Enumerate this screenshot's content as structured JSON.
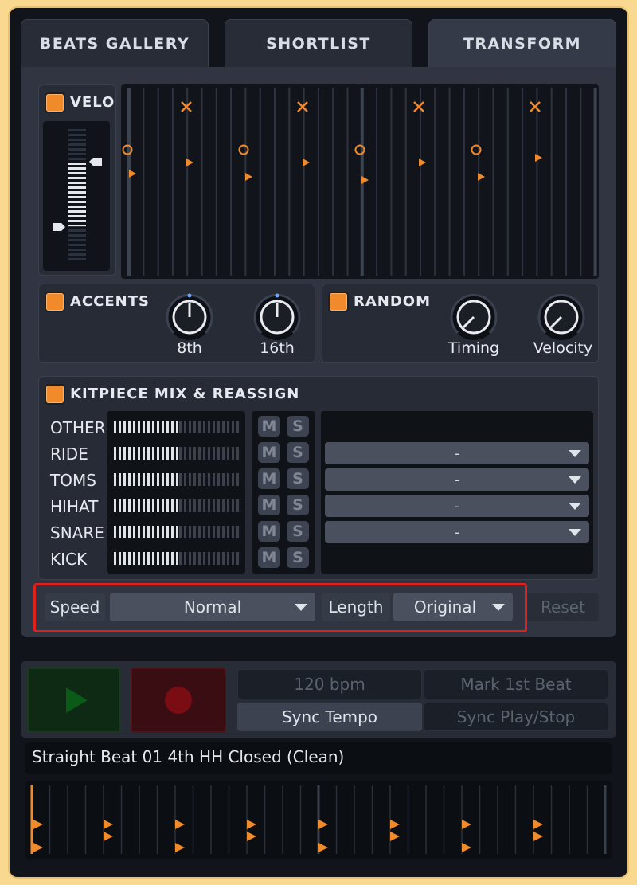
{
  "tabs": [
    {
      "label": "BEATS GALLERY"
    },
    {
      "label": "SHORTLIST"
    },
    {
      "label": "TRANSFORM"
    }
  ],
  "velo": {
    "label": "VELO"
  },
  "accents": {
    "label": "ACCENTS",
    "knobs": [
      {
        "label": "8th"
      },
      {
        "label": "16th"
      }
    ]
  },
  "random": {
    "label": "RANDOM",
    "knobs": [
      {
        "label": "Timing"
      },
      {
        "label": "Velocity"
      }
    ]
  },
  "kitpiece": {
    "label": "KITPIECE MIX & REASSIGN",
    "rows": [
      {
        "name": "OTHER",
        "mute": "M",
        "solo": "S"
      },
      {
        "name": "RIDE",
        "mute": "M",
        "solo": "S",
        "assign": "-"
      },
      {
        "name": "TOMS",
        "mute": "M",
        "solo": "S",
        "assign": "-"
      },
      {
        "name": "HIHAT",
        "mute": "M",
        "solo": "S",
        "assign": "-"
      },
      {
        "name": "SNARE",
        "mute": "M",
        "solo": "S",
        "assign": "-"
      },
      {
        "name": "KICK",
        "mute": "M",
        "solo": "S"
      }
    ]
  },
  "speed": {
    "label": "Speed",
    "value": "Normal"
  },
  "length": {
    "label": "Length",
    "value": "Original"
  },
  "reset_label": "Reset",
  "transport": {
    "bpm": "120 bpm",
    "mark_first_beat": "Mark 1st Beat",
    "sync_tempo": "Sync Tempo",
    "sync_play_stop": "Sync Play/Stop"
  },
  "beat_name": "Straight Beat 01 4th HH Closed (Clean)",
  "colors": {
    "accent": "#f08a2b",
    "highlight_box": "#e0201c"
  }
}
